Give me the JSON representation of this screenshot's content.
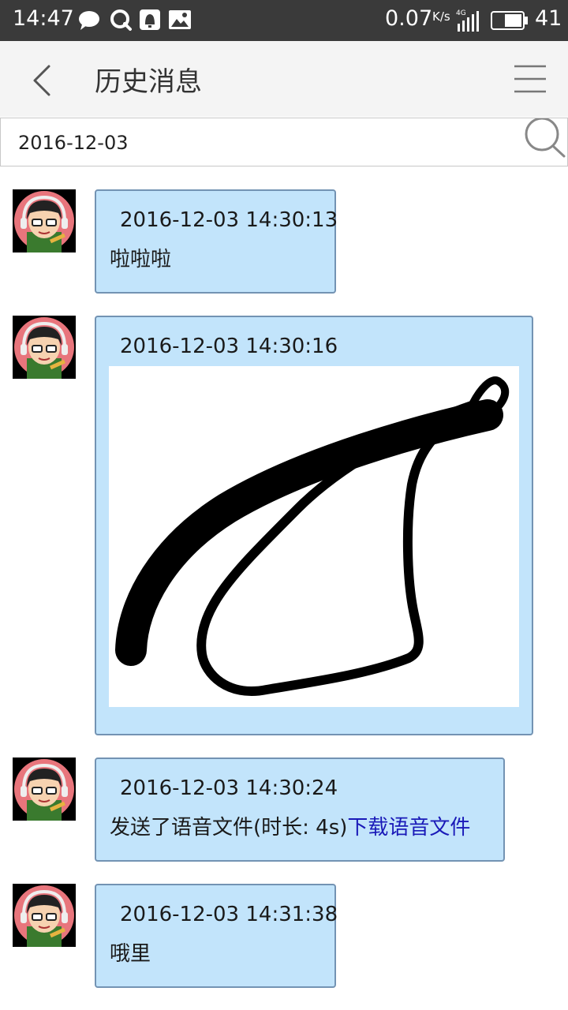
{
  "status_bar": {
    "time": "14:47",
    "network_speed": "0.07",
    "speed_unit": "K/s",
    "network_type": "4G",
    "battery": "41",
    "icons": [
      "message-icon",
      "qq-icon",
      "notification-icon",
      "gallery-icon",
      "signal-icon",
      "battery-icon"
    ]
  },
  "header": {
    "title": "历史消息",
    "back_icon": "chevron-left-icon",
    "menu_icon": "hamburger-menu-icon"
  },
  "search": {
    "value": "2016-12-03",
    "icon": "search-icon"
  },
  "messages": [
    {
      "time": "2016-12-03 14:30:13",
      "type": "text",
      "text": "啦啦啦"
    },
    {
      "time": "2016-12-03 14:30:16",
      "type": "image",
      "image": "hand-drawn black brush stroke sketch"
    },
    {
      "time": "2016-12-03 14:30:24",
      "type": "voice",
      "text": "发送了语音文件(时长: 4s)",
      "link": "下载语音文件"
    },
    {
      "time": "2016-12-03 14:31:38",
      "type": "text",
      "text": "哦里"
    }
  ],
  "colors": {
    "status_bar_bg": "#3a3a3a",
    "header_bg": "#f4f4f4",
    "bubble_bg": "#c2e4fb",
    "bubble_border": "#7393b3",
    "link": "#1a1ab8"
  }
}
